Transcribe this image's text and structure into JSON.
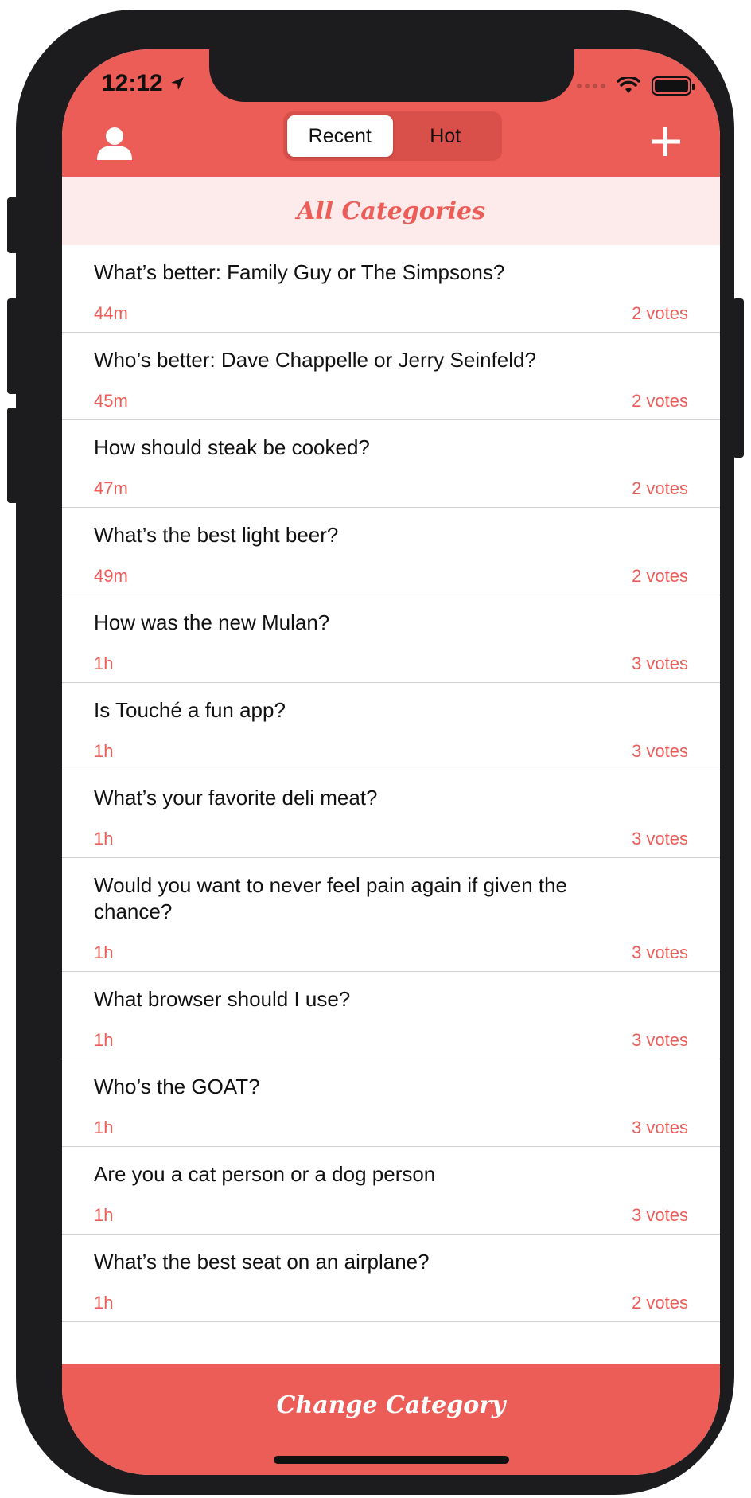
{
  "status": {
    "time": "12:12"
  },
  "header": {
    "tabs": [
      {
        "label": "Recent",
        "active": true
      },
      {
        "label": "Hot",
        "active": false
      }
    ]
  },
  "category": {
    "title": "All Categories"
  },
  "posts": [
    {
      "question": "What’s better: Family Guy or The Simpsons?",
      "age": "44m",
      "votes": "2 votes"
    },
    {
      "question": "Who’s better: Dave Chappelle or Jerry Seinfeld?",
      "age": "45m",
      "votes": "2 votes"
    },
    {
      "question": "How should steak be cooked?",
      "age": "47m",
      "votes": "2 votes"
    },
    {
      "question": "What’s the best light beer?",
      "age": "49m",
      "votes": "2 votes"
    },
    {
      "question": "How was the new Mulan?",
      "age": "1h",
      "votes": "3 votes"
    },
    {
      "question": "Is Touché a fun app?",
      "age": "1h",
      "votes": "3 votes"
    },
    {
      "question": "What’s your favorite deli meat?",
      "age": "1h",
      "votes": "3 votes"
    },
    {
      "question": "Would you want to never feel pain again if given the chance?",
      "age": "1h",
      "votes": "3 votes"
    },
    {
      "question": "What browser should I use?",
      "age": "1h",
      "votes": "3 votes"
    },
    {
      "question": "Who’s the GOAT?",
      "age": "1h",
      "votes": "3 votes"
    },
    {
      "question": "Are you a cat person or a dog person",
      "age": "1h",
      "votes": "3 votes"
    },
    {
      "question": "What’s the best seat on an airplane?",
      "age": "1h",
      "votes": "2 votes"
    }
  ],
  "footer": {
    "button_label": "Change Category"
  },
  "colors": {
    "accent": "#ec5d58",
    "banner_bg": "#fcebea"
  },
  "icons": {
    "profile": "person-icon",
    "add": "plus-icon",
    "location": "location-arrow-icon"
  }
}
